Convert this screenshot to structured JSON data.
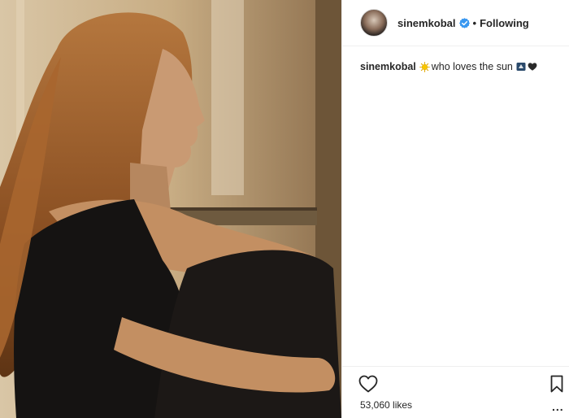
{
  "post": {
    "username": "sinemkobal",
    "follow_status": "Following",
    "separator": "•",
    "caption_text": "who loves the sun",
    "likes": "53,060 likes",
    "more": "..."
  },
  "colors": {
    "text": "#262626",
    "verified": "#3897f0",
    "border": "#efefef"
  },
  "icons": [
    "verified-badge-icon",
    "sun-emoji-icon",
    "heart-icon",
    "bookmark-icon",
    "more-options-icon"
  ]
}
